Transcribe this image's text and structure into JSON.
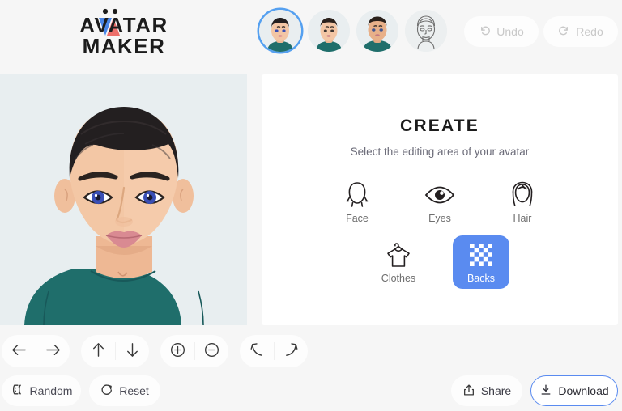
{
  "app": {
    "logo_line1": "AVATAR",
    "logo_line2": "MAKER"
  },
  "header": {
    "thumbnails": [
      {
        "name": "avatar-thumb-1",
        "style": "color-short-hair",
        "selected": true
      },
      {
        "name": "avatar-thumb-2",
        "style": "color-short-hair-alt",
        "selected": false
      },
      {
        "name": "avatar-thumb-3",
        "style": "color-buzz-cut",
        "selected": false
      },
      {
        "name": "avatar-thumb-4",
        "style": "line-art-sketch",
        "selected": false
      }
    ],
    "undo_label": "Undo",
    "redo_label": "Redo",
    "undo_icon": "undo-arrow-icon",
    "redo_icon": "redo-arrow-icon"
  },
  "preview": {
    "background_color": "#e8eef0",
    "hair_color": "#231f20",
    "skin_color": "#f3c6a5",
    "eye_color": "#3a4fb5",
    "shirt_color": "#1f6e6b",
    "lips_color": "#d98a92"
  },
  "create": {
    "title": "CREATE",
    "subtitle": "Select the editing area of your avatar",
    "accent_color": "#5a8bf0",
    "categories_row1": [
      {
        "label": "Face",
        "icon": "face-outline-icon",
        "active": false
      },
      {
        "label": "Eyes",
        "icon": "eye-icon",
        "active": false
      },
      {
        "label": "Hair",
        "icon": "hair-icon",
        "active": false
      }
    ],
    "categories_row2": [
      {
        "label": "Clothes",
        "icon": "tshirt-hanger-icon",
        "active": false
      },
      {
        "label": "Backs",
        "icon": "checkerboard-icon",
        "active": true
      }
    ]
  },
  "tools": {
    "groups": [
      {
        "name": "horizontal-move",
        "buttons": [
          {
            "name": "move-left-button",
            "icon": "arrow-left-icon"
          },
          {
            "name": "move-right-button",
            "icon": "arrow-right-icon"
          }
        ]
      },
      {
        "name": "vertical-move",
        "buttons": [
          {
            "name": "move-up-button",
            "icon": "arrow-up-icon"
          },
          {
            "name": "move-down-button",
            "icon": "arrow-down-icon"
          }
        ]
      },
      {
        "name": "zoom",
        "buttons": [
          {
            "name": "zoom-in-button",
            "icon": "plus-circle-icon"
          },
          {
            "name": "zoom-out-button",
            "icon": "minus-circle-icon"
          }
        ]
      },
      {
        "name": "diagonal-move",
        "buttons": [
          {
            "name": "move-up-left-button",
            "icon": "arrow-up-left-icon"
          },
          {
            "name": "move-up-right-button",
            "icon": "arrow-up-right-icon"
          }
        ]
      }
    ]
  },
  "bottom": {
    "random_label": "Random",
    "random_icon": "shuffle-icon",
    "reset_label": "Reset",
    "reset_icon": "refresh-icon",
    "share_label": "Share",
    "share_icon": "share-upload-icon",
    "download_label": "Download",
    "download_icon": "download-icon",
    "download_border_color": "#5a8bf0"
  }
}
